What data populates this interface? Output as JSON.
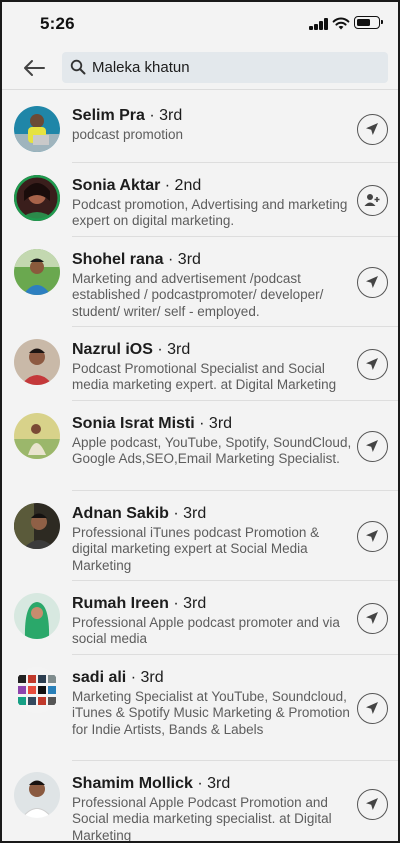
{
  "status_bar": {
    "time": "5:26"
  },
  "search": {
    "query": "Maleka khatun"
  },
  "results": [
    {
      "name": "Selim Pra",
      "degree": " · 3rd",
      "headline": "podcast promotion",
      "action": "message-icon"
    },
    {
      "name": "Sonia Aktar",
      "degree": " · 2nd",
      "headline": "Podcast promotion, Advertising and marketing expert on digital marketing.",
      "action": "connect-icon"
    },
    {
      "name": "Shohel rana",
      "degree": " · 3rd",
      "headline": "Marketing and advertisement /podcast established / podcastpromoter/ developer/ student/ writer/ self - employed.",
      "action": "message-icon"
    },
    {
      "name": "Nazrul iOS",
      "degree": " · 3rd",
      "headline": "Podcast Promotional Specialist and Social media marketing expert. at Digital Marketing",
      "action": "message-icon"
    },
    {
      "name": "Sonia Israt Misti",
      "degree": " · 3rd",
      "headline": "Apple podcast, YouTube, Spotify, SoundCloud, Google Ads,SEO,Email Marketing Specialist.",
      "action": "message-icon"
    },
    {
      "name": "Adnan Sakib",
      "degree": " · 3rd",
      "headline": "Professional iTunes podcast Promotion & digital marketing expert at Social Media Marketing",
      "action": "message-icon"
    },
    {
      "name": "Rumah Ireen",
      "degree": " · 3rd",
      "headline": "Professional Apple podcast promoter and via social media",
      "action": "message-icon"
    },
    {
      "name": "sadi ali",
      "degree": " · 3rd",
      "headline": "Marketing Specialist at YouTube, Soundcloud, iTunes & Spotify Music Marketing & Promotion for Indie Artists, Bands & Labels",
      "action": "message-icon"
    },
    {
      "name": "Shamim Mollick",
      "degree": " · 3rd",
      "headline": "Professional Apple Podcast Promotion and Social media marketing specialist. at Digital Marketing",
      "action": "message-icon"
    }
  ],
  "colors": {
    "background": "#f3f3f3",
    "search_field": "#e3e8ec",
    "secondary_text": "#5d5d5d",
    "divider": "#dddddd"
  }
}
